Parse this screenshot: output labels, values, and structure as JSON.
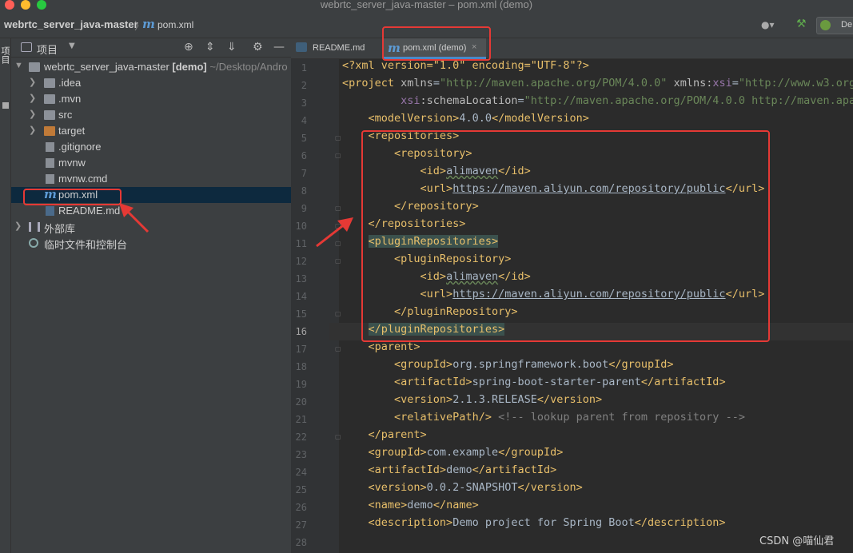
{
  "window": {
    "title": "webrtc_server_java-master – pom.xml (demo)"
  },
  "navbar": {
    "project": "webrtc_server_java-master",
    "separator": "〉",
    "file": "pom.xml",
    "file_icon": "maven-m-icon",
    "run_config": "De"
  },
  "side_strip": {
    "label": "项目"
  },
  "project_panel": {
    "title": "项目",
    "tree": [
      {
        "label": "webrtc_server_java-master",
        "badge": "[demo]",
        "path": "~/Desktop/Andro",
        "icon": "module-folder-icon",
        "expanded": true
      },
      {
        "label": ".idea",
        "icon": "folder-icon"
      },
      {
        "label": ".mvn",
        "icon": "folder-icon"
      },
      {
        "label": "src",
        "icon": "folder-icon"
      },
      {
        "label": "target",
        "icon": "folder-orange-icon"
      },
      {
        "label": ".gitignore",
        "icon": "file-icon"
      },
      {
        "label": "mvnw",
        "icon": "script-icon"
      },
      {
        "label": "mvnw.cmd",
        "icon": "file-icon"
      },
      {
        "label": "pom.xml",
        "icon": "maven-m-icon",
        "selected": true
      },
      {
        "label": "README.md",
        "icon": "markdown-icon"
      },
      {
        "label": "外部库",
        "icon": "library-icon"
      },
      {
        "label": "临时文件和控制台",
        "icon": "scratch-icon"
      }
    ]
  },
  "tabs": [
    {
      "label": "README.md",
      "icon": "markdown-icon",
      "active": false
    },
    {
      "label": "pom.xml (demo)",
      "icon": "maven-m-icon",
      "active": true,
      "close": "×"
    }
  ],
  "editor": {
    "line_numbers": [
      "1",
      "2",
      "3",
      "4",
      "5",
      "6",
      "7",
      "8",
      "9",
      "10",
      "11",
      "12",
      "13",
      "14",
      "15",
      "16",
      "17",
      "18",
      "19",
      "20",
      "21",
      "22",
      "23",
      "24",
      "25",
      "26",
      "27",
      "28"
    ],
    "current_line": "16",
    "text": {
      "l1_xml": "<?xml version=\"1.0\" encoding=\"UTF-8\"?>",
      "l2_project_open": "<project",
      "l2_xmlns": "xmlns",
      "l2_xmlns_val": "\"http://maven.apache.org/POM/4.0.0\"",
      "l2_xsi_ns": "xmlns:",
      "l2_xsi": "xsi",
      "l2_xsi_val": "\"http://www.w3.org/",
      "l3_xsi": "xsi",
      "l3_schema": ":schemaLocation",
      "l3_val": "\"http://maven.apache.org/POM/4.0.0 http://maven.apac",
      "model_version": "4.0.0",
      "repo_id": "alimaven",
      "repo_url": "https://maven.aliyun.com/repository/public",
      "parent_group": "org.springframework.boot",
      "parent_artifact": "spring-boot-starter-parent",
      "parent_version": "2.1.3.RELEASE",
      "relative_path_comment": "<!-- lookup parent from repository -->",
      "group_id": "com.example",
      "artifact_id": "demo",
      "version": "0.0.2-SNAPSHOT",
      "name": "demo",
      "description": "Demo project for Spring Boot"
    }
  },
  "watermark": "CSDN @喵仙君",
  "colors": {
    "annotation_red": "#e53935",
    "tag_yellow": "#e8bf6a",
    "string_green": "#6a8759",
    "namespace_purple": "#9876aa",
    "selection_blue": "#0d293e"
  }
}
